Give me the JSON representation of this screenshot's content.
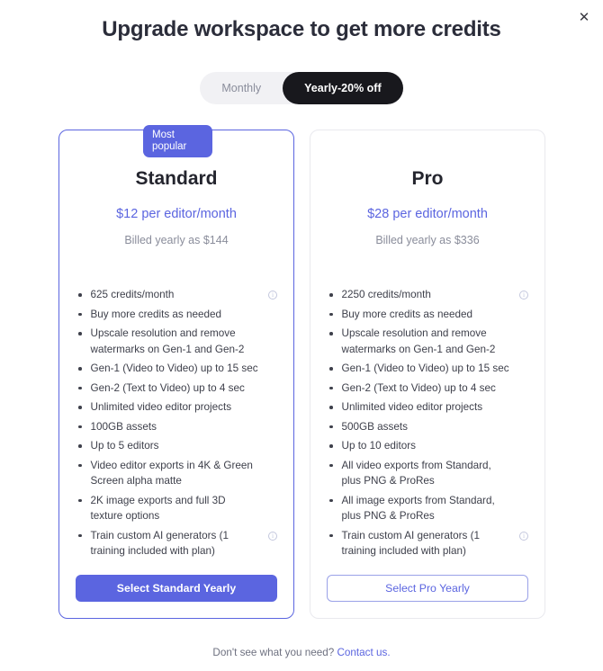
{
  "header": {
    "title": "Upgrade workspace to get more credits",
    "close_label": "✕"
  },
  "billing_toggle": {
    "monthly_label": "Monthly",
    "yearly_label": "Yearly-20% off",
    "selected": "Yearly-20% off"
  },
  "badge": {
    "text": "Most popular"
  },
  "plans": [
    {
      "name": "Standard",
      "price": "$12 per editor/month",
      "billed": "Billed yearly as $144",
      "cta": "Select Standard Yearly",
      "features": [
        {
          "text": "625 credits/month",
          "info": true
        },
        {
          "text": "Buy more credits as needed",
          "info": false
        },
        {
          "text": "Upscale resolution and remove watermarks on Gen-1 and Gen-2",
          "info": false
        },
        {
          "text": "Gen-1 (Video to Video) up to 15 sec",
          "info": false
        },
        {
          "text": "Gen-2 (Text to Video) up to 4 sec",
          "info": false
        },
        {
          "text": "Unlimited video editor projects",
          "info": false
        },
        {
          "text": "100GB assets",
          "info": false
        },
        {
          "text": "Up to 5 editors",
          "info": false
        },
        {
          "text": "Video editor exports in 4K & Green Screen alpha matte",
          "info": false
        },
        {
          "text": "2K image exports and full 3D texture options",
          "info": false
        },
        {
          "text": "Train custom AI generators (1 training included with plan)",
          "info": true
        }
      ]
    },
    {
      "name": "Pro",
      "price": "$28 per editor/month",
      "billed": "Billed yearly as $336",
      "cta": "Select Pro Yearly",
      "features": [
        {
          "text": "2250 credits/month",
          "info": true
        },
        {
          "text": "Buy more credits as needed",
          "info": false
        },
        {
          "text": "Upscale resolution and remove watermarks on Gen-1 and Gen-2",
          "info": false
        },
        {
          "text": "Gen-1 (Video to Video) up to 15 sec",
          "info": false
        },
        {
          "text": "Gen-2 (Text to Video) up to 4 sec",
          "info": false
        },
        {
          "text": "Unlimited video editor projects",
          "info": false
        },
        {
          "text": "500GB assets",
          "info": false
        },
        {
          "text": "Up to 10 editors",
          "info": false
        },
        {
          "text": "All video exports from Standard, plus PNG & ProRes",
          "info": false
        },
        {
          "text": "All image exports from Standard, plus PNG & ProRes",
          "info": false
        },
        {
          "text": "Train custom AI generators (1 training included with plan)",
          "info": true
        }
      ]
    }
  ],
  "footer": {
    "question": "Don't see what you need?",
    "link": "Contact us."
  },
  "colors": {
    "accent": "#5b65e0",
    "toggle_active_bg": "#18181d",
    "title": "#2b2d3a"
  }
}
